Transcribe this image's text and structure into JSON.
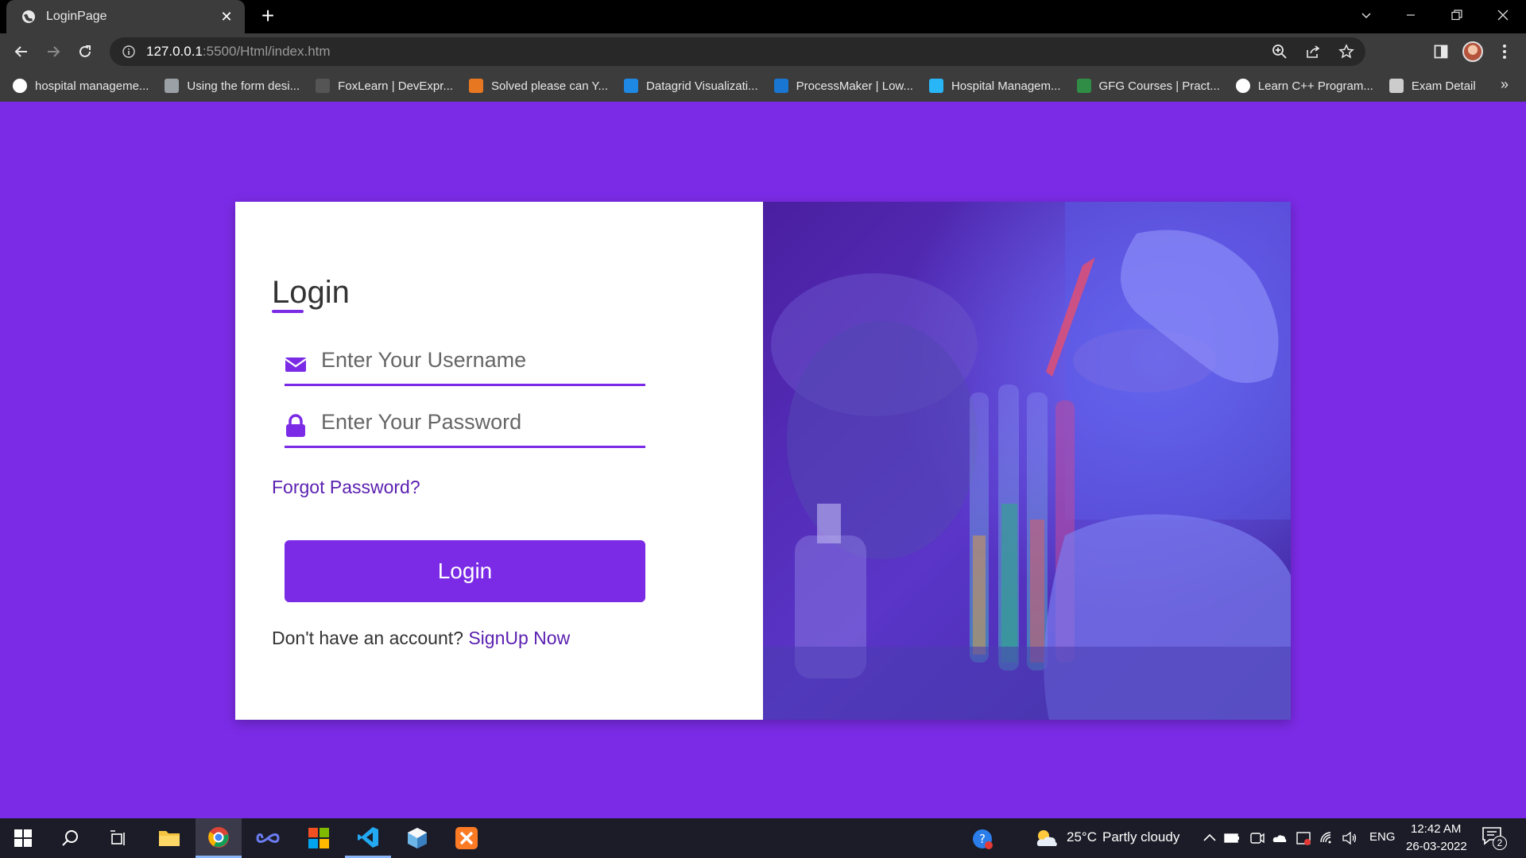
{
  "browser": {
    "tab_title": "LoginPage",
    "tab_close": "✕",
    "new_tab": "+",
    "url_host": "127.0.0.1",
    "url_path": ":5500/Html/index.htm",
    "bookmarks": [
      {
        "label": "hospital manageme...",
        "icon": "google-icon",
        "color": "#ffffff"
      },
      {
        "label": "Using the form desi...",
        "icon": "circle-icon",
        "color": "#9aa0a6"
      },
      {
        "label": "FoxLearn | DevExpr...",
        "icon": "foxlearn-icon",
        "color": "#555555"
      },
      {
        "label": "Solved please can Y...",
        "icon": "chegg-icon",
        "color": "#e87722"
      },
      {
        "label": "Datagrid Visualizati...",
        "icon": "datagrid-icon",
        "color": "#1e88e5"
      },
      {
        "label": "ProcessMaker | Low...",
        "icon": "processmaker-icon",
        "color": "#1976d2"
      },
      {
        "label": "Hospital Managem...",
        "icon": "hospital-icon",
        "color": "#29b6f6"
      },
      {
        "label": "GFG Courses | Pract...",
        "icon": "gfg-icon",
        "color": "#2f8d46"
      },
      {
        "label": "Learn C++ Program...",
        "icon": "globe-icon",
        "color": "#ffffff"
      },
      {
        "label": "Exam Detail",
        "icon": "exam-icon",
        "color": "#cccccc"
      }
    ],
    "bookmarks_more": "»"
  },
  "login": {
    "title": "Login",
    "username_placeholder": "Enter Your Username",
    "password_placeholder": "Enter Your Password",
    "forgot": "Forgot Password?",
    "button": "Login",
    "signup_prompt": "Don't have an account?",
    "signup_link": "SignUp Now"
  },
  "colors": {
    "accent": "#7b2be6",
    "link": "#5a1fb0"
  },
  "taskbar": {
    "weather_temp": "25°C",
    "weather_desc": "Partly cloudy",
    "language": "ENG",
    "time": "12:42 AM",
    "date": "26-03-2022",
    "notifications": "2"
  }
}
